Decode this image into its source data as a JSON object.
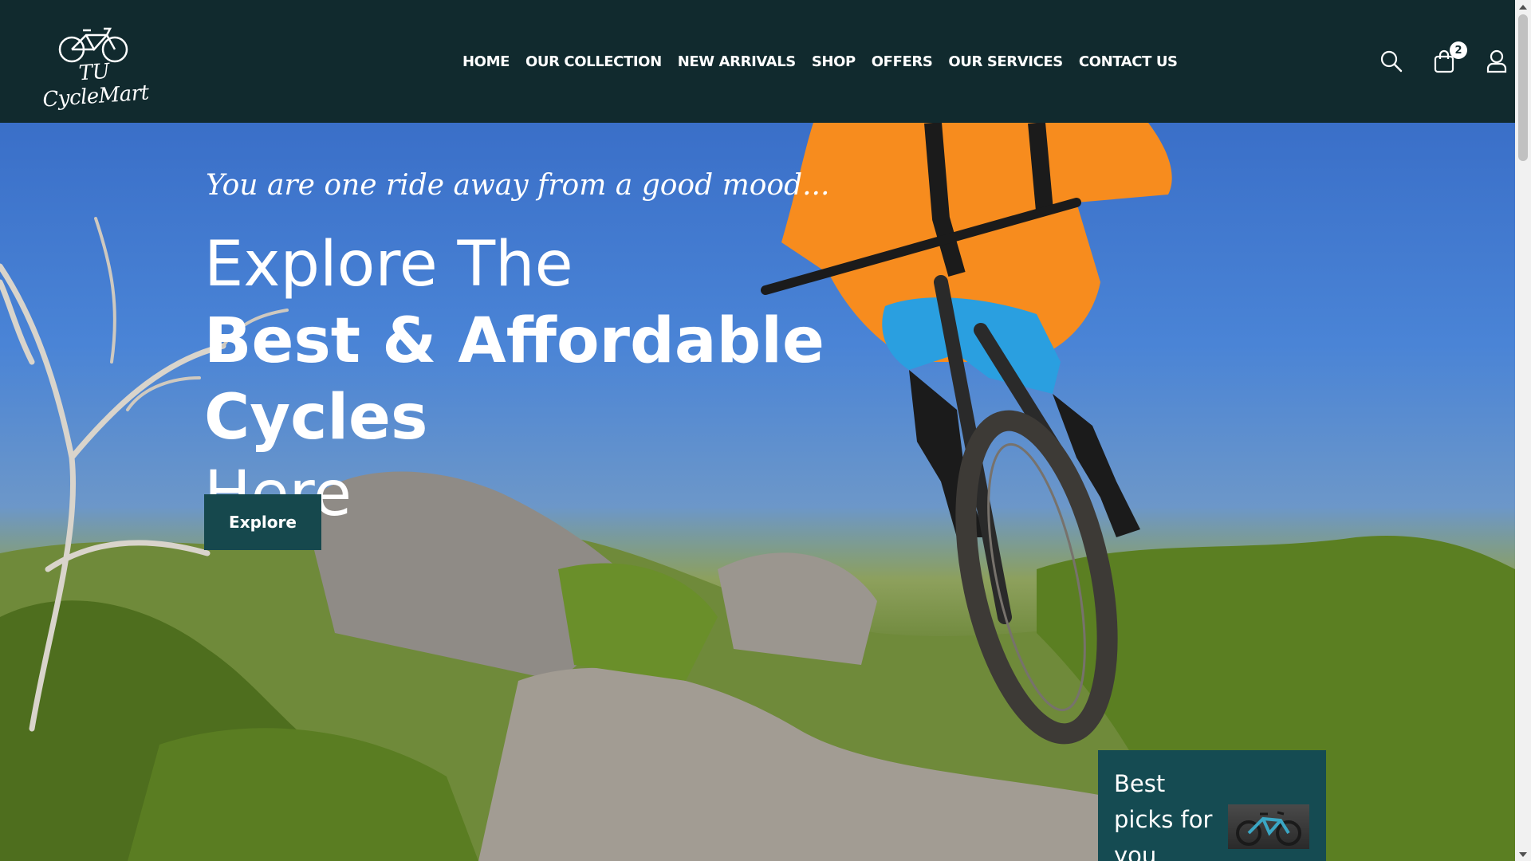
{
  "brand": {
    "logo_text": "TU CycleMart"
  },
  "nav": {
    "items": [
      {
        "label": "HOME"
      },
      {
        "label": "OUR COLLECTION"
      },
      {
        "label": "NEW ARRIVALS"
      },
      {
        "label": "SHOP"
      },
      {
        "label": "OFFERS"
      },
      {
        "label": "OUR SERVICES"
      },
      {
        "label": "CONTACT US"
      }
    ]
  },
  "header_icons": {
    "search": "search-icon",
    "cart": "cart-icon",
    "cart_count": "2",
    "account": "user-icon"
  },
  "hero": {
    "tagline": "You are one ride away from a good mood...",
    "headline_line1": "Explore The",
    "headline_line2": "Best & Affordable Cycles",
    "headline_line3": "Here",
    "cta_label": "Explore"
  },
  "picks_card": {
    "title": "Best picks for you"
  },
  "colors": {
    "header_bg": "#112a2e",
    "button_bg": "#16484d",
    "card_bg": "#154b52",
    "text": "#ffffff"
  }
}
